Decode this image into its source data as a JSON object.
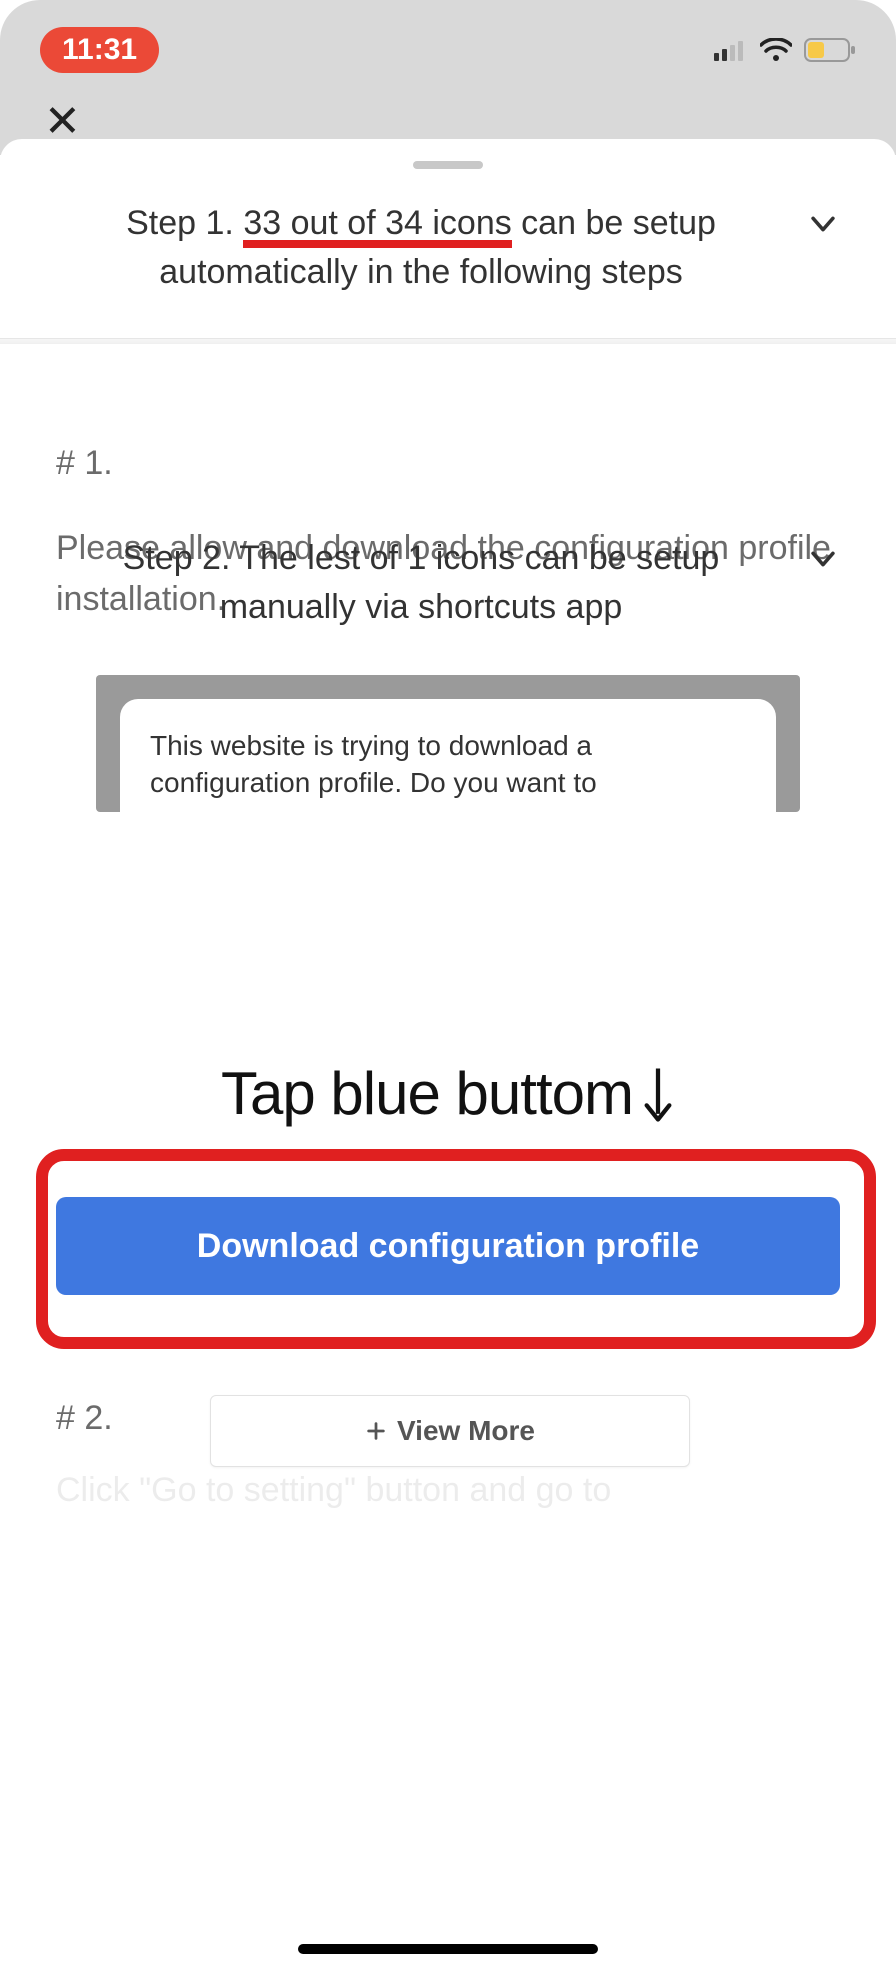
{
  "status": {
    "time": "11:31"
  },
  "sheet": {
    "step1": {
      "prefix": "Step 1. ",
      "underlined": "33 out of 34 icons",
      "suffix": " can be setup automatically in the following steps"
    },
    "sub1": {
      "heading": "# 1.",
      "desc": "Please allow and download the configuration profile installation.",
      "mock_line1": "This website is trying to download a",
      "mock_line2": "configuration profile. Do you want to",
      "hint": "Tap blue buttom",
      "button": "Download configuration profile"
    },
    "sub2": {
      "heading": "# 2.",
      "faded": "Click \"Go to setting\" button and go to",
      "viewmore": "View More"
    },
    "step2": {
      "text": "Step 2. The lest of 1 icons can be setup manually via shortcuts app"
    }
  }
}
